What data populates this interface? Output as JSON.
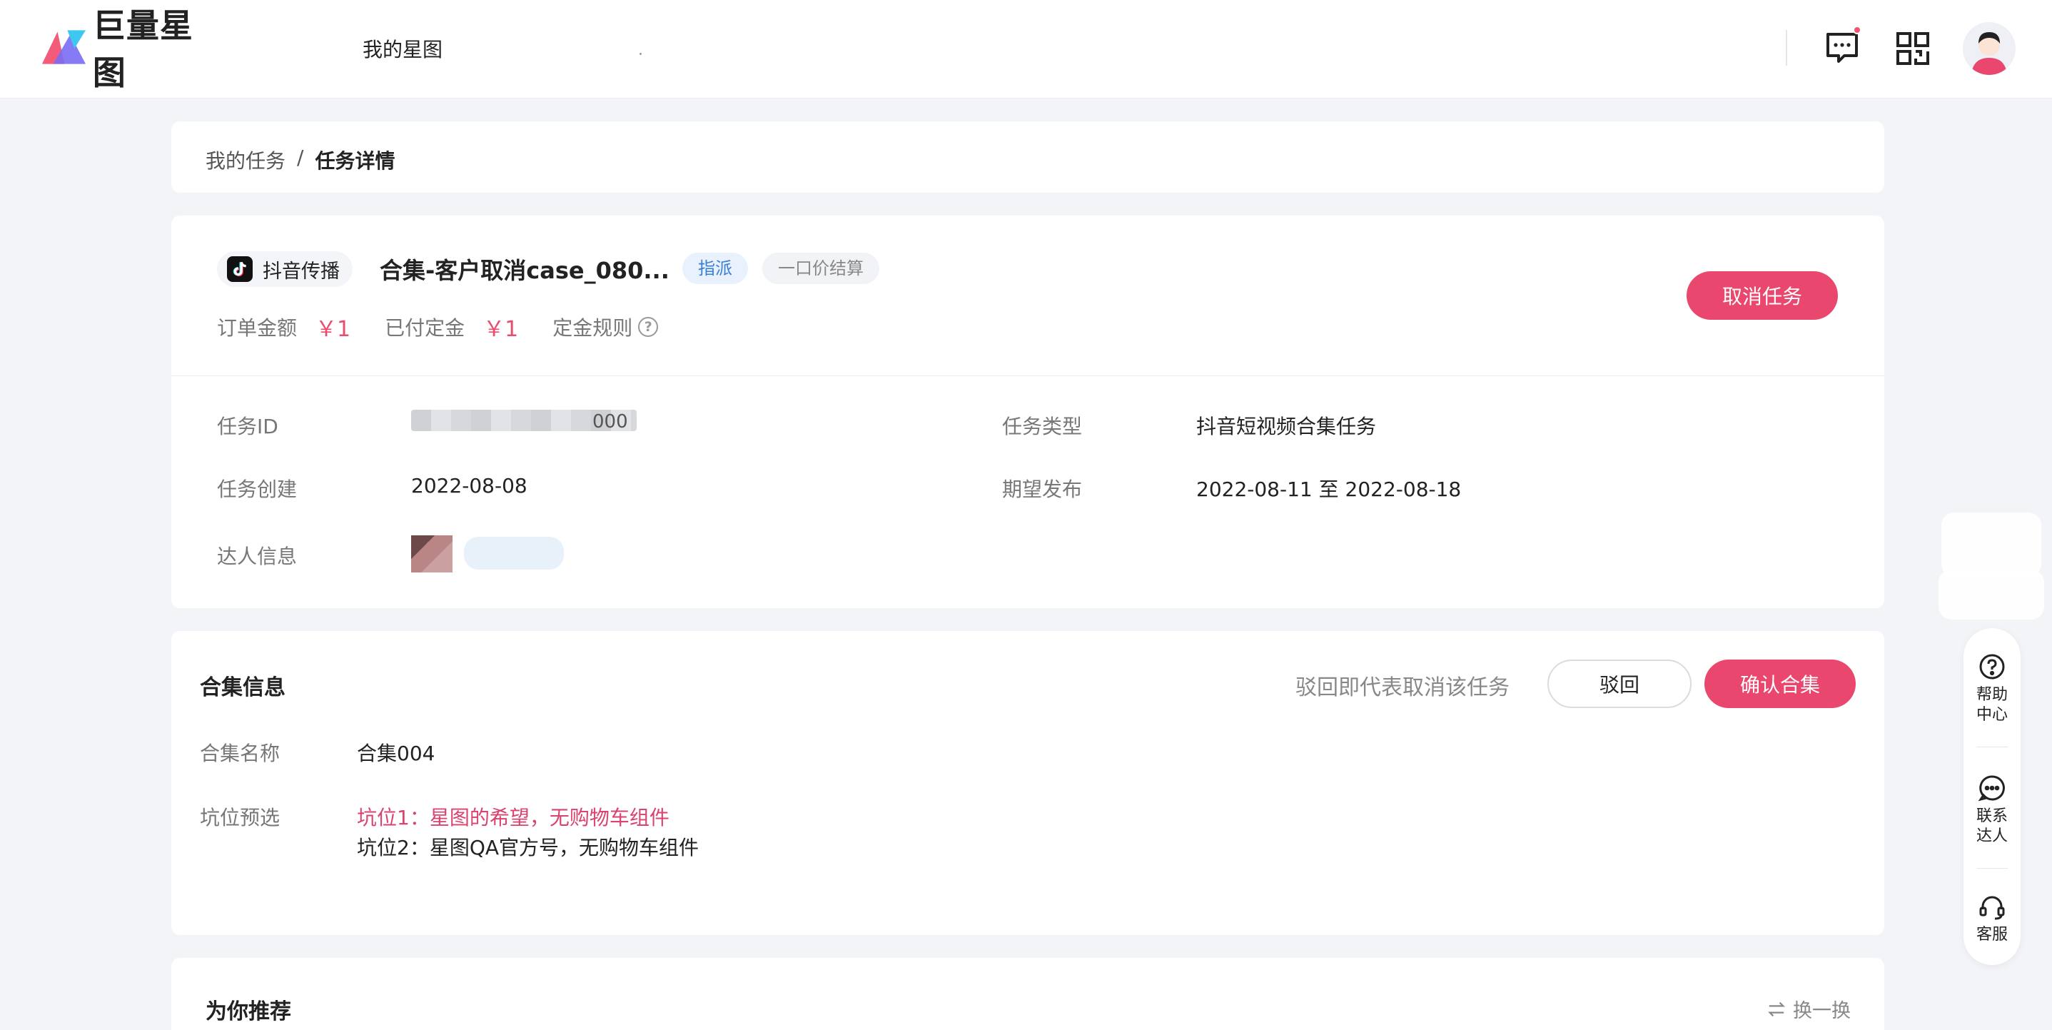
{
  "header": {
    "brand": "巨量星图",
    "nav_my": "我的星图"
  },
  "breadcrumb": {
    "parent": "我的任务",
    "separator": "/",
    "current": "任务详情"
  },
  "task": {
    "platform": "抖音传播",
    "title": "合集-客户取消case_080...",
    "tag_assign": "指派",
    "tag_price": "一口价结算",
    "order_amount_label": "订单金额",
    "order_amount": "￥1",
    "deposit_label": "已付定金",
    "deposit": "￥1",
    "deposit_rule": "定金规则",
    "cancel_button": "取消任务",
    "id_label": "任务ID",
    "id_visible_tail": "000",
    "type_label": "任务类型",
    "type_value": "抖音短视频合集任务",
    "created_label": "任务创建",
    "created_value": "2022-08-08",
    "publish_label": "期望发布",
    "publish_value": "2022-08-11 至 2022-08-18",
    "talent_label": "达人信息"
  },
  "collection": {
    "title": "合集信息",
    "reject_tip": "驳回即代表取消该任务",
    "reject_button": "驳回",
    "confirm_button": "确认合集",
    "name_label": "合集名称",
    "name_value": "合集004",
    "slot_label": "坑位预选",
    "slots": [
      "坑位1：星图的希望，无购物车组件",
      "坑位2：星图QA官方号，无购物车组件"
    ]
  },
  "recommend": {
    "title": "为你推荐",
    "refresh": "换一换"
  },
  "float_bar": {
    "help": [
      "帮助",
      "中心"
    ],
    "contact": [
      "联系",
      "达人"
    ],
    "service": "客服"
  },
  "colors": {
    "accent": "#e9476d",
    "assign_tag": "#3a7fd6",
    "background": "#f3f4f8"
  }
}
